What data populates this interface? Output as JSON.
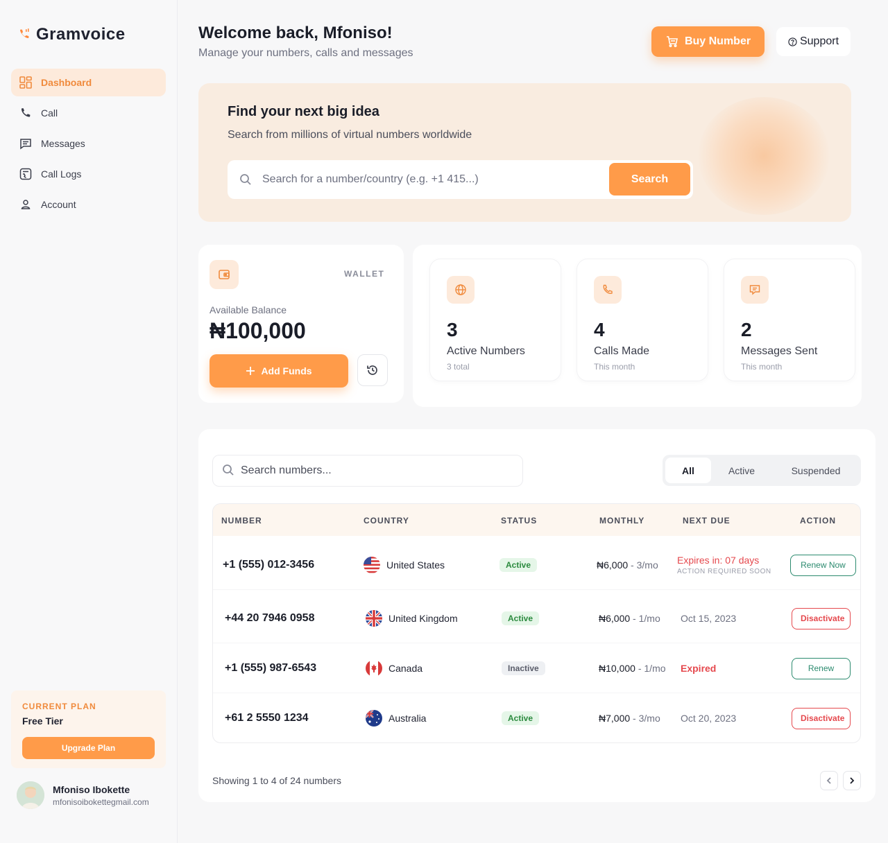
{
  "app": {
    "name": "Gramvoice"
  },
  "sidebar": {
    "items": [
      {
        "label": "Dashboard",
        "icon": "dashboard-icon"
      },
      {
        "label": "Call",
        "icon": "phone-icon"
      },
      {
        "label": "Messages",
        "icon": "message-icon"
      },
      {
        "label": "Call Logs",
        "icon": "call-logs-icon"
      },
      {
        "label": "Account",
        "icon": "user-icon"
      }
    ],
    "plan": {
      "label": "CURRENT PLAN",
      "name": "Free Tier",
      "button": "Upgrade Plan"
    },
    "user": {
      "name": "Mfoniso Ibokette",
      "email": "mfonisoibokettegmail.com"
    }
  },
  "header": {
    "title": "Welcome back, Mfoniso!",
    "subtitle": "Manage your numbers, calls and messages",
    "buy_label": "Buy Number",
    "support_label": "Support"
  },
  "hero": {
    "title": "Find your next big idea",
    "subtitle": "Search from millions of virtual numbers worldwide",
    "placeholder": "Search for a number/country (e.g. +1 415...)",
    "button": "Search"
  },
  "wallet": {
    "tag": "WALLET",
    "label": "Available Balance",
    "balance": "₦100,000",
    "add_funds": "Add Funds"
  },
  "stats": [
    {
      "value": "3",
      "label": "Active Numbers",
      "sub": "3 total",
      "icon": "globe-icon"
    },
    {
      "value": "4",
      "label": "Calls Made",
      "sub": "This month",
      "icon": "phone-icon"
    },
    {
      "value": "2",
      "label": "Messages Sent",
      "sub": "This month",
      "icon": "chat-icon"
    }
  ],
  "numbers": {
    "search_placeholder": "Search numbers...",
    "filters": [
      "All",
      "Active",
      "Suspended"
    ],
    "columns": [
      "NUMBER",
      "COUNTRY",
      "STATUS",
      "MONTHLY",
      "NEXT DUE",
      "ACTION"
    ],
    "rows": [
      {
        "number": "+1 (555) 012-3456",
        "country": "United States",
        "flag": "us",
        "status": "Active",
        "price": "₦6,000",
        "per": "3/mo",
        "due": "Expires in: 07 days",
        "due_sub": "ACTION REQUIRED SOON",
        "action": "Renew Now"
      },
      {
        "number": "+44 20 7946 0958",
        "country": "United Kingdom",
        "flag": "uk",
        "status": "Active",
        "price": "₦6,000",
        "per": "1/mo",
        "due": "Oct 15, 2023",
        "due_sub": "",
        "action": "Disactivate"
      },
      {
        "number": "+1 (555) 987-6543",
        "country": "Canada",
        "flag": "ca",
        "status": "Inactive",
        "price": "₦10,000",
        "per": "1/mo",
        "due": "Expired",
        "due_sub": "",
        "action": "Renew"
      },
      {
        "number": "+61 2 5550 1234",
        "country": "Australia",
        "flag": "au",
        "status": "Active",
        "price": "₦7,000",
        "per": "3/mo",
        "due": "Oct 20, 2023",
        "due_sub": "",
        "action": "Disactivate"
      }
    ],
    "showing": "Showing 1 to 4 of 24 numbers"
  },
  "colors": {
    "accent": "#ff9b49",
    "accent_light": "#fdeadb",
    "success": "#2b8a3e",
    "danger": "#e5484d"
  }
}
